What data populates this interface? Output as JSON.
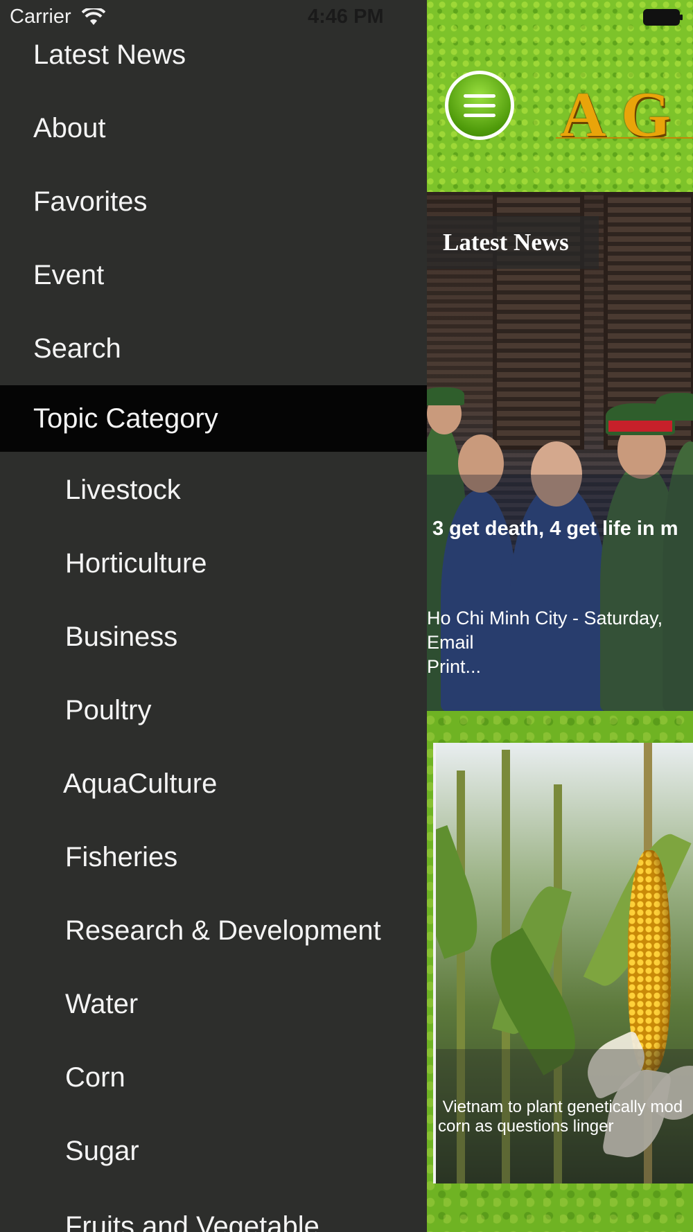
{
  "status_bar": {
    "carrier": "Carrier",
    "time": "4:46 PM",
    "wifi_icon": "wifi-icon",
    "battery_icon": "battery-icon"
  },
  "menu": {
    "top_items": [
      {
        "label": "Latest News"
      },
      {
        "label": "About"
      },
      {
        "label": "Favorites"
      },
      {
        "label": "Event"
      },
      {
        "label": "Search"
      }
    ],
    "active_item": {
      "label": "Topic Category"
    },
    "sub_items": [
      {
        "label": "Livestock"
      },
      {
        "label": "Horticulture"
      },
      {
        "label": "Business"
      },
      {
        "label": "Poultry"
      },
      {
        "label": "AquaCulture"
      },
      {
        "label": "Fisheries"
      },
      {
        "label": "Research & Development"
      },
      {
        "label": "Water"
      },
      {
        "label": "Corn"
      },
      {
        "label": "Sugar"
      },
      {
        "label": "Fruits and Vegetable"
      }
    ]
  },
  "header": {
    "menu_icon": "hamburger-menu-icon",
    "logo_text": "A G"
  },
  "news": {
    "section_label": "Latest News",
    "headline": "3 get death, 4 get life in m",
    "summary": "Ho Chi Minh City - Saturday,\nEmail\nPrint..."
  },
  "corn_story": {
    "caption": " Vietnam to plant genetically mod\ncorn as questions linger"
  },
  "colors": {
    "menu_background": "#2d2e2c",
    "menu_active": "#050505",
    "header_green": "#7dc32a",
    "logo_gold": "#e9a40a"
  }
}
